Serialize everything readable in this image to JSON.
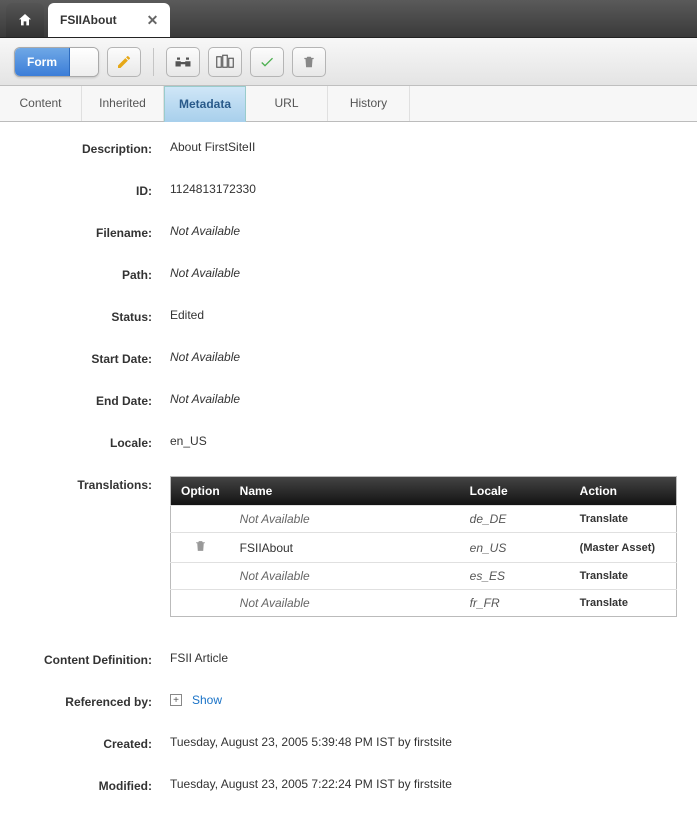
{
  "tab": {
    "title": "FSIIAbout"
  },
  "toolbar": {
    "form_label": "Form"
  },
  "subtabs": {
    "content": "Content",
    "inherited": "Inherited",
    "metadata": "Metadata",
    "url": "URL",
    "history": "History"
  },
  "fields": {
    "description_label": "Description:",
    "description": "About FirstSiteII",
    "id_label": "ID:",
    "id": "1124813172330",
    "filename_label": "Filename:",
    "filename": "Not Available",
    "path_label": "Path:",
    "path": "Not Available",
    "status_label": "Status:",
    "status": "Edited",
    "start_label": "Start Date:",
    "start": "Not Available",
    "end_label": "End Date:",
    "end": "Not Available",
    "locale_label": "Locale:",
    "locale": "en_US",
    "translations_label": "Translations:",
    "contentdef_label": "Content Definition:",
    "contentdef": "FSII Article",
    "refby_label": "Referenced by:",
    "refby_show": "Show",
    "created_label": "Created:",
    "created": "Tuesday, August 23, 2005 5:39:48 PM IST by firstsite",
    "modified_label": "Modified:",
    "modified": "Tuesday, August 23, 2005 7:22:24 PM IST by firstsite"
  },
  "trans_header": {
    "option": "Option",
    "name": "Name",
    "locale": "Locale",
    "action": "Action"
  },
  "translations": [
    {
      "opt": "",
      "name": "Not Available",
      "na": true,
      "locale": "de_DE",
      "action": "Translate"
    },
    {
      "opt": "trash",
      "name": "FSIIAbout",
      "na": false,
      "locale": "en_US",
      "action": "(Master Asset)"
    },
    {
      "opt": "",
      "name": "Not Available",
      "na": true,
      "locale": "es_ES",
      "action": "Translate"
    },
    {
      "opt": "",
      "name": "Not Available",
      "na": true,
      "locale": "fr_FR",
      "action": "Translate"
    }
  ]
}
